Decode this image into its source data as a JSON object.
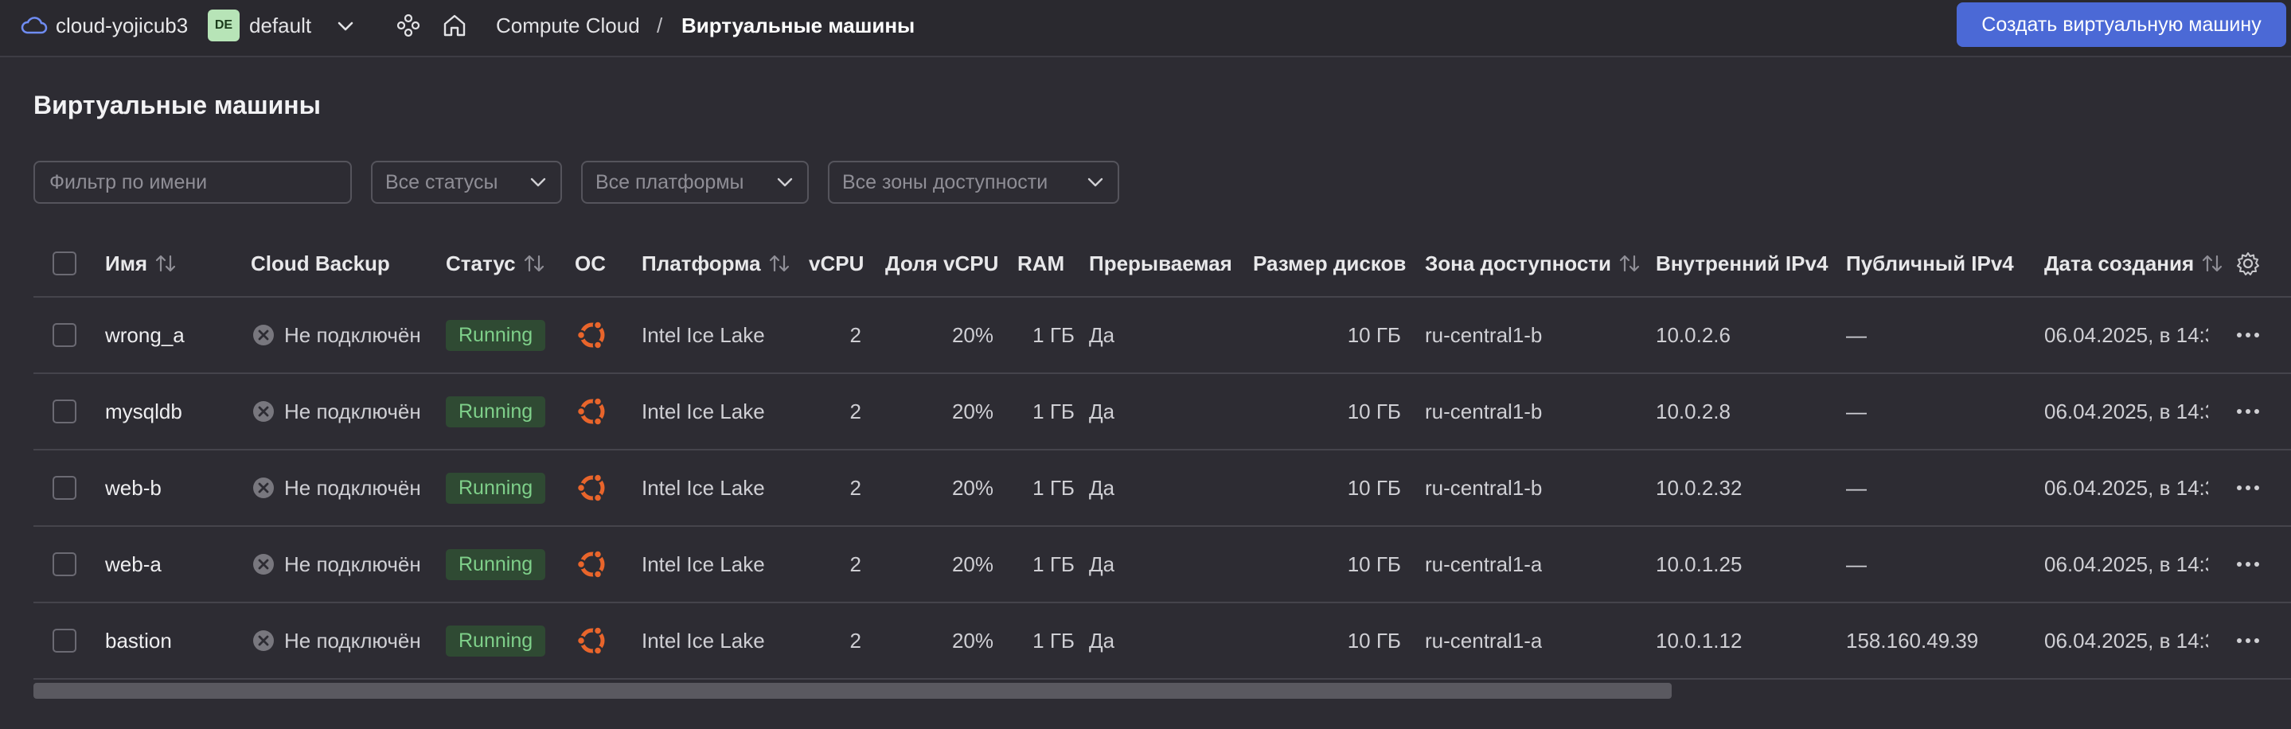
{
  "topbar": {
    "cloud_name": "cloud-yojicub3",
    "folder_avatar": "DE",
    "folder_name": "default",
    "breadcrumb_service": "Compute Cloud",
    "breadcrumb_separator": "/",
    "breadcrumb_current": "Виртуальные машины",
    "create_button": "Создать виртуальную машину",
    "icons": [
      "cloud-icon",
      "chevron-down-icon",
      "services-icon",
      "home-icon"
    ]
  },
  "page": {
    "title": "Виртуальные машины"
  },
  "filters": {
    "name_placeholder": "Фильтр по имени",
    "status_value": "Все статусы",
    "platform_value": "Все платформы",
    "zone_value": "Все зоны доступности"
  },
  "table": {
    "columns": {
      "name": "Имя",
      "backup": "Cloud Backup",
      "status": "Статус",
      "os": "ОС",
      "platform": "Платформа",
      "vcpu": "vCPU",
      "vcpu_share": "Доля vCPU",
      "ram": "RAM",
      "preemptible": "Прерываемая",
      "disk_size": "Размер дисков",
      "zone": "Зона доступности",
      "internal_ip": "Внутренний IPv4",
      "public_ip": "Публичный IPv4",
      "created": "Дата создания"
    },
    "rows": [
      {
        "name": "wrong_a",
        "backup": "Не подключён",
        "status": "Running",
        "os": "ubuntu-icon",
        "platform": "Intel Ice Lake",
        "vcpu": "2",
        "vcpu_share": "20%",
        "ram": "1 ГБ",
        "preemptible": "Да",
        "disk_size": "10 ГБ",
        "zone": "ru-central1-b",
        "internal_ip": "10.0.2.6",
        "public_ip": "—",
        "created": "06.04.2025, в 14:3"
      },
      {
        "name": "mysqldb",
        "backup": "Не подключён",
        "status": "Running",
        "os": "ubuntu-icon",
        "platform": "Intel Ice Lake",
        "vcpu": "2",
        "vcpu_share": "20%",
        "ram": "1 ГБ",
        "preemptible": "Да",
        "disk_size": "10 ГБ",
        "zone": "ru-central1-b",
        "internal_ip": "10.0.2.8",
        "public_ip": "—",
        "created": "06.04.2025, в 14:3"
      },
      {
        "name": "web-b",
        "backup": "Не подключён",
        "status": "Running",
        "os": "ubuntu-icon",
        "platform": "Intel Ice Lake",
        "vcpu": "2",
        "vcpu_share": "20%",
        "ram": "1 ГБ",
        "preemptible": "Да",
        "disk_size": "10 ГБ",
        "zone": "ru-central1-b",
        "internal_ip": "10.0.2.32",
        "public_ip": "—",
        "created": "06.04.2025, в 14:3"
      },
      {
        "name": "web-a",
        "backup": "Не подключён",
        "status": "Running",
        "os": "ubuntu-icon",
        "platform": "Intel Ice Lake",
        "vcpu": "2",
        "vcpu_share": "20%",
        "ram": "1 ГБ",
        "preemptible": "Да",
        "disk_size": "10 ГБ",
        "zone": "ru-central1-a",
        "internal_ip": "10.0.1.25",
        "public_ip": "—",
        "created": "06.04.2025, в 14:3"
      },
      {
        "name": "bastion",
        "backup": "Не подключён",
        "status": "Running",
        "os": "ubuntu-icon",
        "platform": "Intel Ice Lake",
        "vcpu": "2",
        "vcpu_share": "20%",
        "ram": "1 ГБ",
        "preemptible": "Да",
        "disk_size": "10 ГБ",
        "zone": "ru-central1-a",
        "internal_ip": "10.0.1.12",
        "public_ip": "158.160.49.39",
        "created": "06.04.2025, в 14:3"
      }
    ]
  },
  "colors": {
    "accent": "#4b69d6",
    "running_bg": "#2f4a33",
    "running_text": "#7fd08a",
    "ubuntu": "#e9652b"
  }
}
